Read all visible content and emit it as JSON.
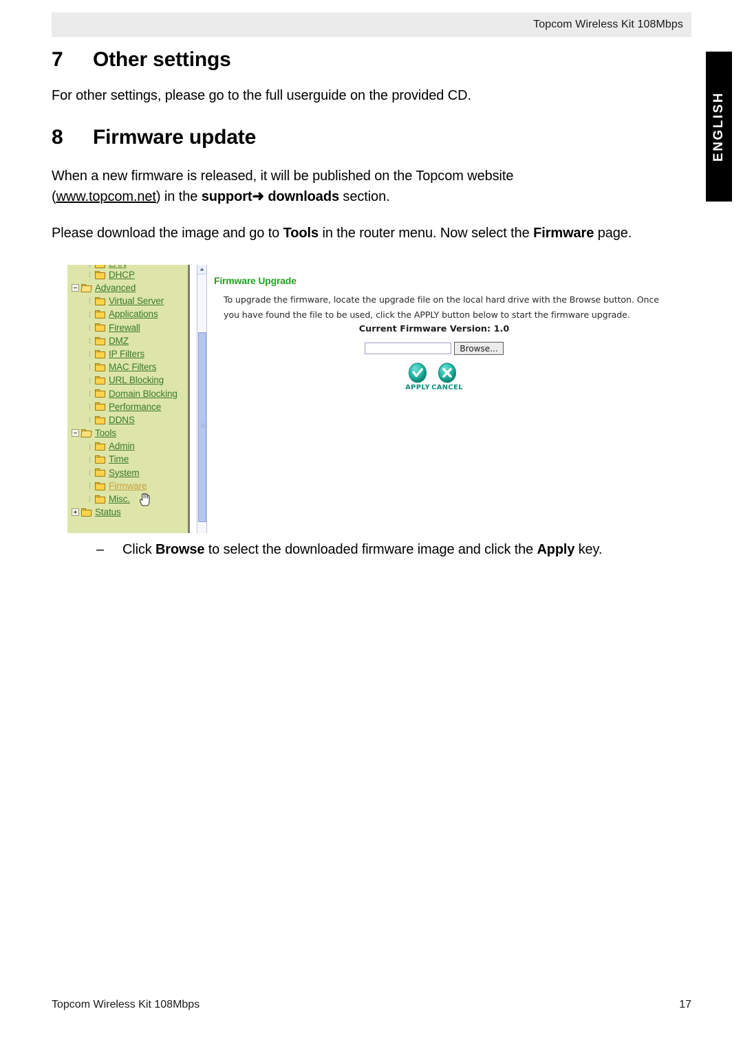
{
  "header": {
    "title": "Topcom Wireless Kit 108Mbps"
  },
  "language_tab": {
    "label": "ENGLISH"
  },
  "sections": [
    {
      "number": "7",
      "title": "Other settings",
      "paragraph": "For other settings, please go to the full userguide on the provided CD."
    },
    {
      "number": "8",
      "title": "Firmware update"
    }
  ],
  "firmware_section": {
    "para1_part1": "When a new firmware is released, it will be published on the Topcom website",
    "para1_open_paren": "(",
    "para1_link": "www.topcom.net",
    "para1_part2": ") in the ",
    "para1_bold1": "support",
    "para1_arrow": "➜",
    "para1_bold2": "downloads",
    "para1_part3": " section.",
    "para2_part1": "Please download the image and go to ",
    "para2_bold1": "Tools",
    "para2_part2": " in the router menu. Now select the ",
    "para2_bold2": "Firmware",
    "para2_part3": " page.",
    "bullet_dash": "–",
    "bullet_part1": "Click ",
    "bullet_bold1": "Browse",
    "bullet_part2": " to select the downloaded firmware image and click the ",
    "bullet_bold2": "Apply",
    "bullet_part3": " key."
  },
  "router_screenshot": {
    "tree": [
      {
        "label": "LAN",
        "indent": 1,
        "marker": "dot",
        "folder": "closed",
        "clipped": true,
        "state": "normal"
      },
      {
        "label": "DHCP",
        "indent": 1,
        "marker": "dot",
        "folder": "closed",
        "clipped": false,
        "state": "normal"
      },
      {
        "label": "Advanced",
        "indent": 0,
        "marker": "minus",
        "folder": "open",
        "clipped": false,
        "state": "normal"
      },
      {
        "label": "Virtual Server",
        "indent": 1,
        "marker": "dot",
        "folder": "closed",
        "clipped": false,
        "state": "normal"
      },
      {
        "label": "Applications",
        "indent": 1,
        "marker": "dot",
        "folder": "closed",
        "clipped": false,
        "state": "normal"
      },
      {
        "label": "Firewall",
        "indent": 1,
        "marker": "dot",
        "folder": "closed",
        "clipped": false,
        "state": "normal"
      },
      {
        "label": "DMZ",
        "indent": 1,
        "marker": "dot",
        "folder": "closed",
        "clipped": false,
        "state": "normal"
      },
      {
        "label": "IP Filters",
        "indent": 1,
        "marker": "dot",
        "folder": "closed",
        "clipped": false,
        "state": "normal"
      },
      {
        "label": "MAC Filters",
        "indent": 1,
        "marker": "dot",
        "folder": "closed",
        "clipped": false,
        "state": "normal"
      },
      {
        "label": "URL Blocking",
        "indent": 1,
        "marker": "dot",
        "folder": "closed",
        "clipped": false,
        "state": "normal"
      },
      {
        "label": "Domain Blocking",
        "indent": 1,
        "marker": "dot",
        "folder": "closed",
        "clipped": false,
        "state": "normal"
      },
      {
        "label": "Performance",
        "indent": 1,
        "marker": "dot",
        "folder": "closed",
        "clipped": false,
        "state": "normal"
      },
      {
        "label": "DDNS",
        "indent": 1,
        "marker": "dot",
        "folder": "closed",
        "clipped": false,
        "state": "normal"
      },
      {
        "label": "Tools",
        "indent": 0,
        "marker": "minus",
        "folder": "open",
        "clipped": false,
        "state": "normal"
      },
      {
        "label": "Admin",
        "indent": 1,
        "marker": "dot",
        "folder": "closed",
        "clipped": false,
        "state": "normal"
      },
      {
        "label": "Time",
        "indent": 1,
        "marker": "dot",
        "folder": "closed",
        "clipped": false,
        "state": "normal"
      },
      {
        "label": "System",
        "indent": 1,
        "marker": "dot",
        "folder": "closed",
        "clipped": false,
        "state": "normal"
      },
      {
        "label": "Firmware",
        "indent": 1,
        "marker": "dot",
        "folder": "closed",
        "clipped": false,
        "state": "hovered"
      },
      {
        "label": "Misc.",
        "indent": 1,
        "marker": "dot",
        "folder": "closed",
        "clipped": false,
        "state": "normal"
      },
      {
        "label": "Status",
        "indent": 0,
        "marker": "plus",
        "folder": "closed",
        "clipped": false,
        "state": "normal"
      }
    ],
    "panel": {
      "title": "Firmware Upgrade",
      "description": "To upgrade the firmware, locate the upgrade file on the local hard drive with the Browse button. Once you have found the file to be used, click the APPLY button below to start the firmware upgrade.",
      "firmware_version_label": "Current Firmware Version: 1.0",
      "file_field_value": "",
      "browse_button": "Browse...",
      "apply_label": "APPLY",
      "cancel_label": "CANCEL"
    },
    "colors": {
      "tree_background": "#dde5a8",
      "tree_link": "#3a7a2c",
      "tree_link_hover": "#c8a03c",
      "panel_title": "#21a021",
      "action_teal": "#16a899"
    }
  },
  "footer": {
    "left": "Topcom Wireless Kit 108Mbps",
    "page_number": "17"
  }
}
